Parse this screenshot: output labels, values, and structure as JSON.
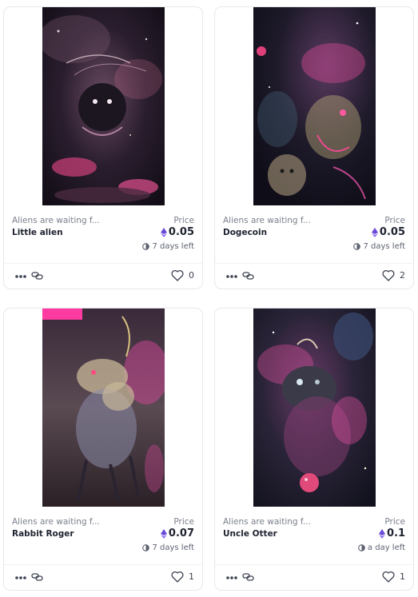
{
  "cards": [
    {
      "collection": "Aliens are waiting f...",
      "name": "Little alien",
      "price_label": "Price",
      "price": "0.05",
      "time_left": "7 days left",
      "likes": "0",
      "art_palette": [
        "#1b1320",
        "#c84a86",
        "#3a2a3e"
      ]
    },
    {
      "collection": "Aliens are waiting f...",
      "name": "Dogecoin",
      "price_label": "Price",
      "price": "0.05",
      "time_left": "7 days left",
      "likes": "2",
      "art_palette": [
        "#171623",
        "#d04a92",
        "#3a4a58"
      ]
    },
    {
      "collection": "Aliens are waiting f...",
      "name": "Rabbit Roger",
      "price_label": "Price",
      "price": "0.07",
      "time_left": "7 days left",
      "likes": "1",
      "art_palette": [
        "#2a2230",
        "#e04aa0",
        "#6a5a62"
      ]
    },
    {
      "collection": "Aliens are waiting f...",
      "name": "Uncle Otter",
      "price_label": "Price",
      "price": "0.1",
      "time_left": "a day left",
      "likes": "1",
      "art_palette": [
        "#1a1a2a",
        "#d8509a",
        "#3a3a50"
      ]
    }
  ],
  "icons": {
    "currency": "ethereum-icon",
    "time": "clock-icon",
    "more": "more-dots-icon",
    "link": "link-icon",
    "like": "heart-icon"
  },
  "colors": {
    "eth": "#6a4bd8",
    "border": "#e7e8ec",
    "muted_text": "#7a7f8b"
  }
}
